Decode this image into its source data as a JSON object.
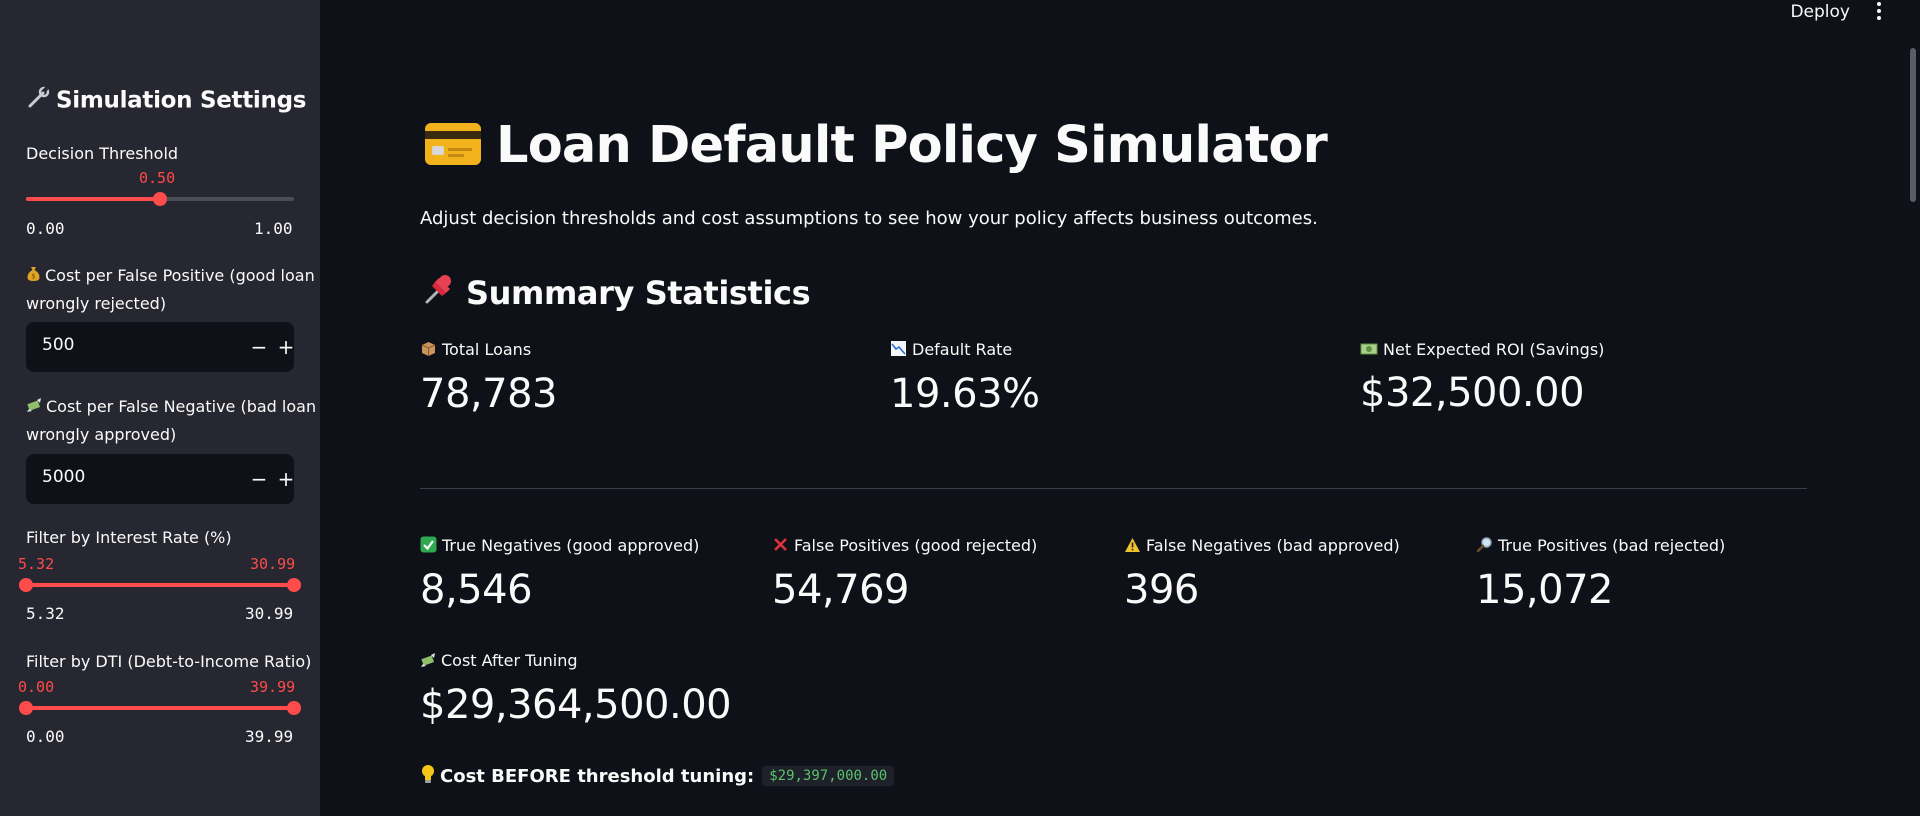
{
  "header": {
    "deploy_label": "Deploy"
  },
  "sidebar": {
    "title": "Simulation Settings",
    "threshold": {
      "label": "Decision Threshold",
      "value": "0.50",
      "min": "0.00",
      "max": "1.00",
      "fraction": 0.5
    },
    "fp_cost": {
      "label_line1": "Cost per False Positive (good loan",
      "label_line2": "wrongly rejected)",
      "value": "500",
      "minus": "−",
      "plus": "+"
    },
    "fn_cost": {
      "label_line1": "Cost per False Negative (bad loan",
      "label_line2": "wrongly approved)",
      "value": "5000",
      "minus": "−",
      "plus": "+"
    },
    "interest_filter": {
      "label": "Filter by Interest Rate (%)",
      "low": "5.32",
      "high": "30.99",
      "min": "5.32",
      "max": "30.99"
    },
    "dti_filter": {
      "label": "Filter by DTI (Debt-to-Income Ratio)",
      "low": "0.00",
      "high": "39.99",
      "min": "0.00",
      "max": "39.99"
    }
  },
  "main": {
    "title": "Loan Default Policy Simulator",
    "subtitle": "Adjust decision thresholds and cost assumptions to see how your policy affects business outcomes.",
    "summary_heading": "Summary Statistics",
    "metrics_top": [
      {
        "label": "Total Loans",
        "value": "78,783",
        "icon": "package-icon"
      },
      {
        "label": "Default Rate",
        "value": "19.63%",
        "icon": "chart-decreasing-icon"
      },
      {
        "label": "Net Expected ROI (Savings)",
        "value": "$32,500.00",
        "icon": "dollar-bill-icon"
      }
    ],
    "metrics_confusion": [
      {
        "label": "True Negatives (good approved)",
        "value": "8,546",
        "icon": "check-mark-icon"
      },
      {
        "label": "False Positives (good rejected)",
        "value": "54,769",
        "icon": "cross-mark-icon"
      },
      {
        "label": "False Negatives (bad approved)",
        "value": "396",
        "icon": "warning-icon"
      },
      {
        "label": "True Positives (bad rejected)",
        "value": "15,072",
        "icon": "magnifier-icon"
      }
    ],
    "cost_after": {
      "label": "Cost After Tuning",
      "value": "$29,364,500.00",
      "icon": "money-wings-icon"
    },
    "cost_before": {
      "label": "Cost BEFORE threshold tuning:",
      "value": "$29,397,000.00"
    }
  },
  "colors": {
    "accent": "#ff4b4b",
    "background": "#0e1117",
    "sidebar": "#262730",
    "code_green": "#5ac26a"
  }
}
